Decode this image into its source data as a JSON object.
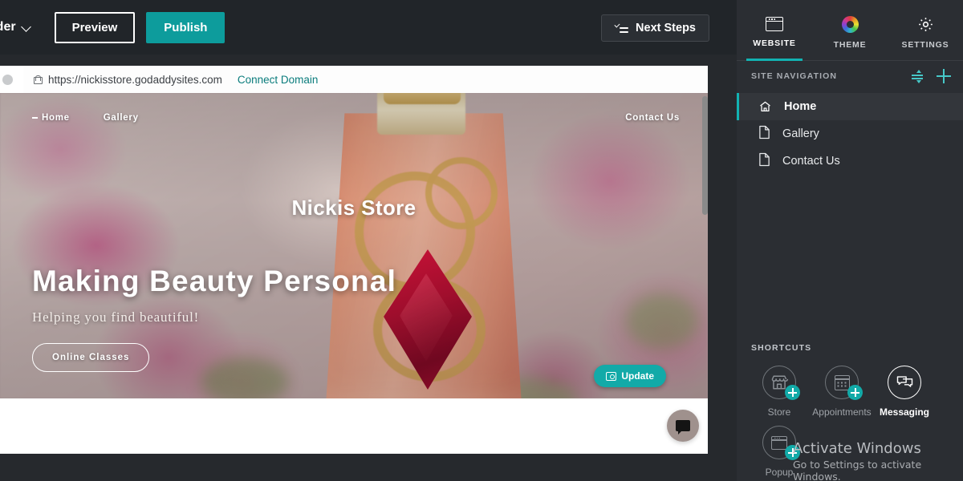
{
  "topbar": {
    "brand_label": "uilder",
    "brand_icon": "chevron-down-icon",
    "preview_label": "Preview",
    "publish_label": "Publish",
    "next_steps_label": "Next Steps",
    "next_steps_icon": "checklist-icon",
    "publish_color": "#0d9c9c"
  },
  "browser": {
    "lock_icon": "lock-icon",
    "url": "https://nickisstore.godaddysites.com",
    "connect_domain_label": "Connect Domain",
    "connect_domain_color": "#0a7c7c"
  },
  "preview": {
    "site_nav": [
      {
        "label": "Home"
      },
      {
        "label": "Gallery"
      },
      {
        "label": "Contact Us"
      }
    ],
    "site_title": "Nickis Store",
    "hero_heading": "Making Beauty Personal",
    "hero_subheading": "Helping you find beautiful!",
    "hero_cta_label": "Online Classes",
    "update_label": "Update",
    "update_icon": "camera-icon",
    "update_color": "#12aaa8",
    "chat_icon": "chat-bubble-icon"
  },
  "panel": {
    "tabs": [
      {
        "label": "WEBSITE",
        "icon": "browser-window-icon",
        "active": true
      },
      {
        "label": "THEME",
        "icon": "color-wheel-icon",
        "active": false
      },
      {
        "label": "SETTINGS",
        "icon": "gear-icon",
        "active": false
      }
    ],
    "accent_color": "#12b2b2",
    "site_navigation": {
      "title": "SITE NAVIGATION",
      "reorder_icon": "sort-reorder-icon",
      "add_icon": "plus-icon",
      "items": [
        {
          "label": "Home",
          "icon": "home-icon",
          "active": true
        },
        {
          "label": "Gallery",
          "icon": "page-icon",
          "active": false
        },
        {
          "label": "Contact Us",
          "icon": "page-icon",
          "active": false
        }
      ]
    },
    "shortcuts": {
      "title": "SHORTCUTS",
      "items": [
        {
          "label": "Store",
          "icon": "storefront-icon",
          "has_add_badge": true,
          "highlighted": false
        },
        {
          "label": "Appointments",
          "icon": "calendar-icon",
          "has_add_badge": true,
          "highlighted": false
        },
        {
          "label": "Messaging",
          "icon": "messages-icon",
          "has_add_badge": false,
          "highlighted": true
        },
        {
          "label": "Popup",
          "icon": "popup-window-icon",
          "has_add_badge": true,
          "highlighted": false
        }
      ]
    }
  },
  "watermark": {
    "title": "Activate Windows",
    "subtitle": "Go to Settings to activate Windows."
  }
}
